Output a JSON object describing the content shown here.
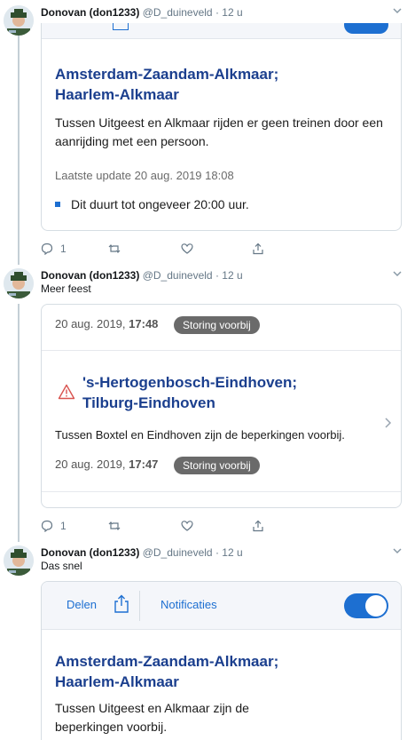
{
  "tweets": [
    {
      "name": "Donovan (don1233)",
      "handle": "@D_duineveld",
      "dot": "·",
      "time": "12 u",
      "text": "",
      "card": {
        "route": "Amsterdam-Zaandam-Alkmaar; Haarlem-Alkmaar",
        "body": "Tussen Uitgeest en Alkmaar rijden er geen treinen door een aanrijding met een persoon.",
        "update": "Laatste update 20 aug. 2019 18:08",
        "bullet": "Dit duurt tot ongeveer 20:00 uur."
      },
      "actions": {
        "reply_count": "1"
      }
    },
    {
      "name": "Donovan (don1233)",
      "handle": "@D_duineveld",
      "dot": "·",
      "time": "12 u",
      "text": "Meer feest",
      "card": {
        "date": "20 aug. 2019,",
        "time": "17:48",
        "badge": "Storing voorbij",
        "route": "'s-Hertogenbosch-Eindhoven; Tilburg-Eindhoven",
        "body": "Tussen Boxtel en Eindhoven zijn de beperkingen voorbij.",
        "date2": "20 aug. 2019,",
        "time2": "17:47",
        "badge2": "Storing voorbij"
      },
      "actions": {
        "reply_count": "1"
      }
    },
    {
      "name": "Donovan (don1233)",
      "handle": "@D_duineveld",
      "dot": "·",
      "time": "12 u",
      "text": "Das snel",
      "card": {
        "share_label": "Delen",
        "notify_label": "Notificaties",
        "route": "Amsterdam-Zaandam-Alkmaar; Haarlem-Alkmaar",
        "body": "Tussen Uitgeest en Alkmaar zijn de beperkingen voorbij."
      }
    }
  ],
  "colors": {
    "route_blue": "#1b3f8e",
    "accent_blue": "#1d6fd1",
    "badge_grey": "#6a6a6a",
    "warning_red": "#d9534f"
  },
  "icons": [
    "reply-icon",
    "retweet-icon",
    "like-icon",
    "share-icon",
    "chevron-down-icon",
    "chevron-right-icon",
    "warning-icon",
    "share-box-icon"
  ]
}
